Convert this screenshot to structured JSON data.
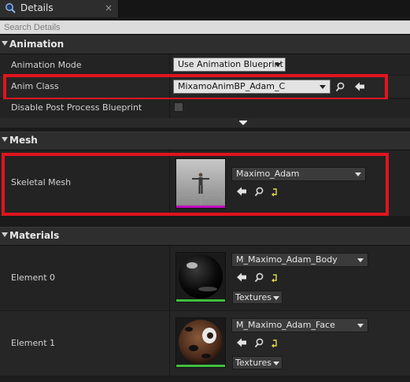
{
  "tab": {
    "title": "Details",
    "close": "×"
  },
  "search": {
    "placeholder": "Search Details"
  },
  "categories": {
    "animation": "Animation",
    "mesh": "Mesh",
    "materials": "Materials"
  },
  "animation": {
    "mode_label": "Animation Mode",
    "mode_value": "Use Animation Blueprint",
    "class_label": "Anim Class",
    "class_value": "MixamoAnimBP_Adam_C",
    "disable_pp_label": "Disable Post Process Blueprint",
    "disable_pp_checked": false
  },
  "mesh": {
    "skeletal_label": "Skeletal Mesh",
    "skeletal_value": "Maximo_Adam"
  },
  "materials": {
    "element0_label": "Element 0",
    "element0_value": "M_Maximo_Adam_Body",
    "element1_label": "Element 1",
    "element1_value": "M_Maximo_Adam_Face",
    "textures_label": "Textures"
  },
  "colors": {
    "highlight": "#e0141e",
    "mesh_thumb_bar": "#c000c0",
    "material_thumb_bar": "#3fbf3f"
  }
}
